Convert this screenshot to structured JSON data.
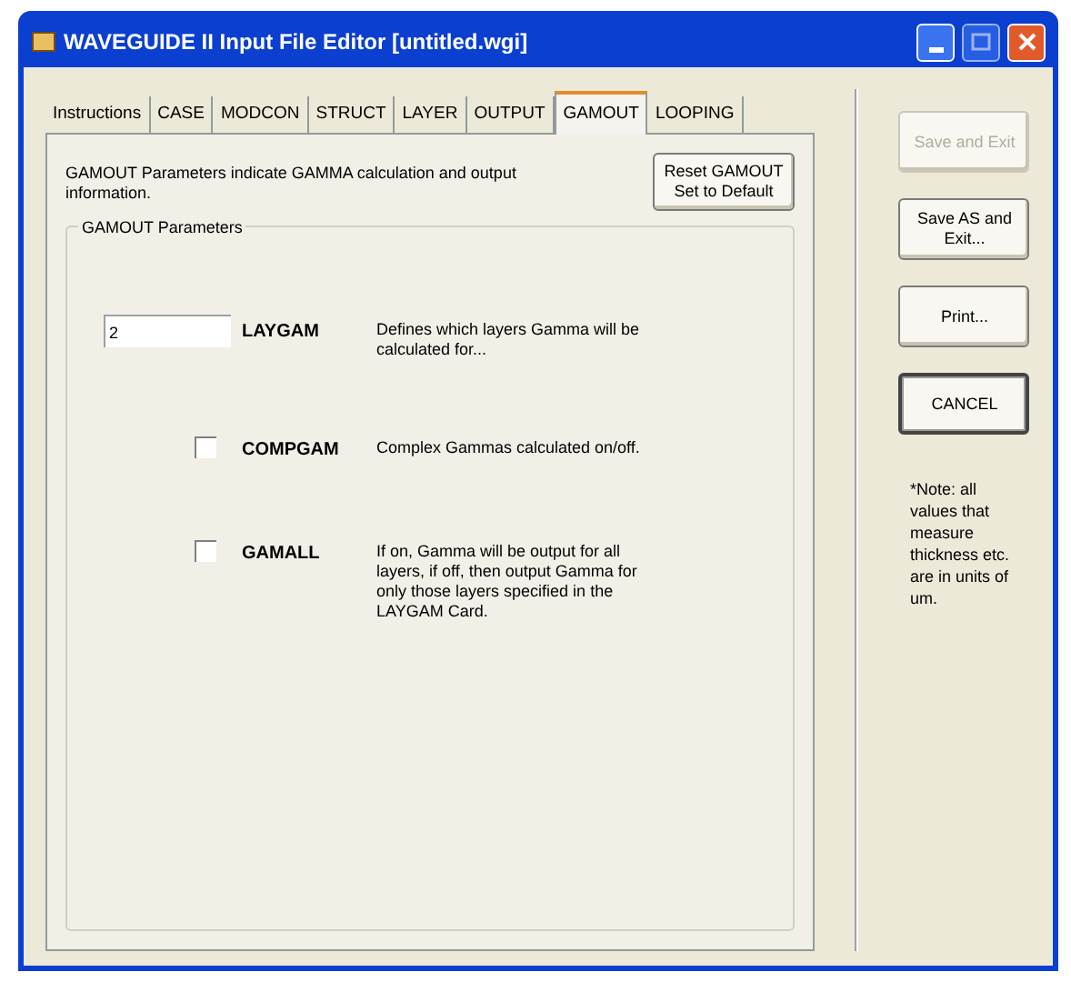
{
  "window": {
    "title": "WAVEGUIDE II Input File Editor [untitled.wgi]"
  },
  "tabs": [
    {
      "label": "Instructions",
      "selected": false
    },
    {
      "label": "CASE",
      "selected": false
    },
    {
      "label": "MODCON",
      "selected": false
    },
    {
      "label": "STRUCT",
      "selected": false
    },
    {
      "label": "LAYER",
      "selected": false
    },
    {
      "label": "OUTPUT",
      "selected": false
    },
    {
      "label": "GAMOUT",
      "selected": true
    },
    {
      "label": "LOOPING",
      "selected": false
    }
  ],
  "panel": {
    "intro": "GAMOUT Parameters indicate GAMMA calculation and output information.",
    "reset_button": "Reset GAMOUT Set to Default",
    "group_title": "GAMOUT Parameters",
    "params": [
      {
        "kind": "field",
        "name": "LAYGAM",
        "value": "2",
        "description": "Defines which layers Gamma will be calculated for..."
      },
      {
        "kind": "checkbox",
        "name": "COMPGAM",
        "checked": false,
        "description": "Complex Gammas calculated on/off."
      },
      {
        "kind": "checkbox",
        "name": "GAMALL",
        "checked": false,
        "description": "If on, Gamma will be output for all layers, if off, then output Gamma for only those layers specified in the LAYGAM Card."
      }
    ]
  },
  "side_buttons": [
    {
      "label": "Save and Exit",
      "disabled": true,
      "default": false
    },
    {
      "label": "Save AS and Exit...",
      "disabled": false,
      "default": false
    },
    {
      "label": "Print...",
      "disabled": false,
      "default": false
    },
    {
      "label": "CANCEL",
      "disabled": false,
      "default": true
    }
  ],
  "note": "*Note: all values that measure thickness etc. are in units of um."
}
